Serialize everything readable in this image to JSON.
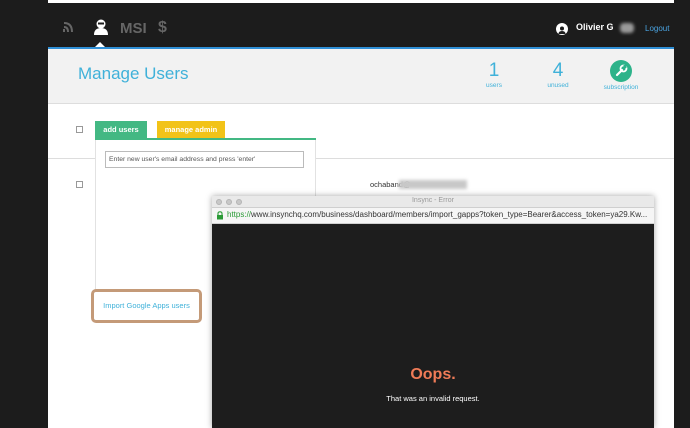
{
  "nav": {
    "msi_label": "MSI",
    "dollar_label": "$",
    "user_name": "Olivier G",
    "logout_label": "Logout"
  },
  "header": {
    "title": "Manage Users",
    "stats": [
      {
        "value": "1",
        "label": "users"
      },
      {
        "value": "4",
        "label": "unused"
      }
    ],
    "subscription_label": "subscription"
  },
  "tabs": {
    "add_users": "add users",
    "manage_admin": "manage admin"
  },
  "form": {
    "email_placeholder": "Enter new user's email address and press 'enter'",
    "import_button": "Import Google Apps users"
  },
  "row": {
    "email_prefix": "ochaband@"
  },
  "popup": {
    "title": "Insync - Error",
    "url_scheme": "https://",
    "url_rest": "www.insynchq.com/business/dashboard/members/import_gapps?token_type=Bearer&access_token=ya29.Kw...",
    "heading": "Oops.",
    "message": "That was an invalid request."
  },
  "colors": {
    "accent_blue": "#3fb1d9",
    "green": "#43b883",
    "yellow": "#f2c318",
    "oops": "#f07b57",
    "dark": "#1c1c1c"
  },
  "icons": {
    "nav_signal": "wifi-signal-icon",
    "nav_user": "user-icon",
    "avatar": "user-avatar-icon",
    "subscription": "wrench-icon",
    "lock": "lock-icon"
  }
}
